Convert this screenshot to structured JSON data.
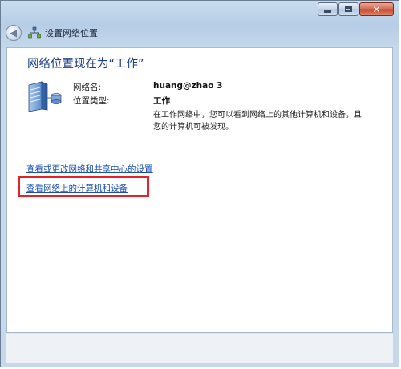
{
  "window": {
    "title": "设置网络位置",
    "controls": {
      "minimize": "minimize",
      "maximize": "maximize",
      "close": "✕"
    }
  },
  "nav": {
    "back_icon": "back-arrow-icon",
    "back_glyph": "◀"
  },
  "main": {
    "heading": "网络位置现在为“工作”",
    "network_name_label": "网络名:",
    "network_name_value": "huang@zhao  3",
    "location_type_label": "位置类型:",
    "location_type_value": "工作",
    "description": "在工作网络中，您可以看到网络上的其他计算机和设备，且您的计算机可被发现。",
    "links": [
      {
        "label": "查看或更改网络和共享中心的设置"
      },
      {
        "label": "查看网络上的计算机和设备"
      }
    ]
  },
  "colors": {
    "heading": "#1e3f8a",
    "link": "#1a4fb4",
    "highlight": "#e8202a"
  }
}
